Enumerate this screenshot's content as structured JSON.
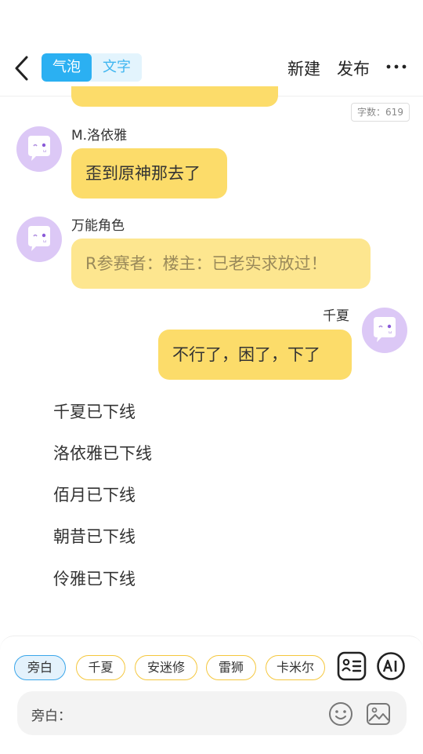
{
  "header": {
    "tab_bubble": "气泡",
    "tab_text": "文字",
    "new_label": "新建",
    "publish_label": "发布",
    "more_label": "···",
    "word_count": "字数：619"
  },
  "messages": [
    {
      "name": "M.洛依雅",
      "text": "歪到原神那去了",
      "side": "left"
    },
    {
      "name": "万能角色",
      "text": "R参赛者：楼主：已老实求放过！",
      "side": "left"
    },
    {
      "name": "千夏",
      "text": "不行了，困了，下了",
      "side": "right"
    }
  ],
  "status_lines": [
    "千夏已下线",
    "洛依雅已下线",
    "佰月已下线",
    "朝昔已下线",
    "伶雅已下线"
  ],
  "characters": [
    "旁白",
    "千夏",
    "安迷修",
    "雷狮",
    "卡米尔"
  ],
  "input": {
    "label": "旁白："
  },
  "icons": [
    "back-icon",
    "more-icon",
    "card-icon",
    "ai-icon",
    "emoji-icon",
    "image-icon",
    "avatar-icon"
  ],
  "colors": {
    "accent": "#2bb0f2",
    "bubble": "#fcdc6a",
    "avatar": "#dcc8f6",
    "chip_border": "#f5c73d"
  }
}
